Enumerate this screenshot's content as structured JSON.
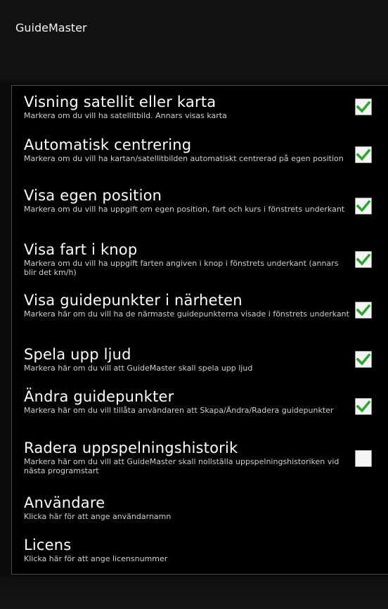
{
  "app": {
    "title": "GuideMaster"
  },
  "settings": [
    {
      "title": "Visning satellit eller karta",
      "summary": "Markera om du vill ha satellitbild. Annars visas karta",
      "checked": true
    },
    {
      "title": "Automatisk centrering",
      "summary": "Markera om du vill ha kartan/satellitbilden automatiskt centrerad på egen position",
      "checked": true
    },
    {
      "title": "Visa egen position",
      "summary": "Markera om du vill ha uppgift om egen position, fart och kurs i fönstrets underkant",
      "checked": true
    },
    {
      "title": "Visa fart i knop",
      "summary": "Markera om du vill ha uppgift farten angiven i knop i fönstrets underkant (annars blir det km/h)",
      "checked": true
    },
    {
      "title": "Visa guidepunkter i närheten",
      "summary": "Markera här om du vill ha de närmaste guidepunkterna visade i fönstrets underkant",
      "checked": true
    },
    {
      "title": "Spela upp ljud",
      "summary": "Markera här om du vill att GuideMaster skall spela upp ljud",
      "checked": true
    },
    {
      "title": "Ändra guidepunkter",
      "summary": "Markera här om du vill tillåta användaren att Skapa/Ändra/Radera guidepunkter",
      "checked": true
    },
    {
      "title": "Radera uppspelningshistorik",
      "summary": "Markera här om du vill att GuideMaster skall nollställa uppspelningshistoriken vid nästa programstart",
      "checked": false
    },
    {
      "title": "Användare",
      "summary": "Klicka här för att ange användarnamn"
    },
    {
      "title": "Licens",
      "summary": "Klicka här för att ange licensnummer"
    }
  ],
  "colors": {
    "check": "#2fa52f",
    "checkbox_bg": "#f4f4f4"
  },
  "icons": {
    "checkbox_checked": "checkmark-icon"
  }
}
